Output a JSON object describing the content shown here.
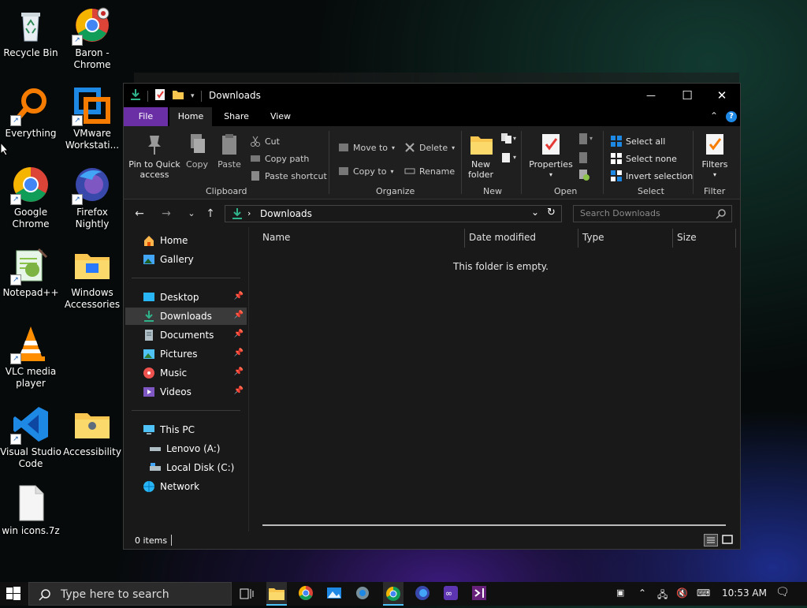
{
  "desktop": {
    "icons": [
      {
        "label": "Recycle Bin",
        "icon": "recycle-bin-icon"
      },
      {
        "label": "Baron - Chrome",
        "icon": "chrome-icon"
      },
      {
        "label": "Everything",
        "icon": "everything-search-icon"
      },
      {
        "label": "VMware Workstati...",
        "icon": "vmware-icon"
      },
      {
        "label": "Google Chrome",
        "icon": "chrome-icon"
      },
      {
        "label": "Firefox Nightly",
        "icon": "firefox-nightly-icon"
      },
      {
        "label": "Notepad++",
        "icon": "notepadpp-icon"
      },
      {
        "label": "Windows Accessories",
        "icon": "folder-icon"
      },
      {
        "label": "VLC media player",
        "icon": "vlc-icon"
      },
      {
        "label": "Visual Studio Code",
        "icon": "vscode-icon"
      },
      {
        "label": "Accessibility",
        "icon": "folder-icon"
      },
      {
        "label": "win icons.7z",
        "icon": "file-icon"
      }
    ]
  },
  "explorer": {
    "title": "Downloads",
    "window_controls": {
      "minimize": "—",
      "maximize": "☐",
      "close": "✕"
    },
    "tabs": {
      "file": "File",
      "home": "Home",
      "share": "Share",
      "view": "View"
    },
    "ribbon": {
      "clipboard": {
        "pin": "Pin to Quick access",
        "copy": "Copy",
        "paste": "Paste",
        "cut": "Cut",
        "copy_path": "Copy path",
        "paste_shortcut": "Paste shortcut",
        "label": "Clipboard"
      },
      "organize": {
        "move_to": "Move to",
        "copy_to": "Copy to",
        "delete": "Delete",
        "rename": "Rename",
        "label": "Organize"
      },
      "new": {
        "new_folder": "New folder",
        "label": "New"
      },
      "open": {
        "properties": "Properties",
        "label": "Open"
      },
      "select": {
        "select_all": "Select all",
        "select_none": "Select none",
        "invert": "Invert selection",
        "label": "Select"
      },
      "filter": {
        "filters": "Filters",
        "label": "Filter"
      }
    },
    "address": {
      "path": "Downloads",
      "search_placeholder": "Search Downloads"
    },
    "nav": {
      "home": "Home",
      "gallery": "Gallery",
      "quick": [
        "Desktop",
        "Downloads",
        "Documents",
        "Pictures",
        "Music",
        "Videos"
      ],
      "this_pc": "This PC",
      "drives": [
        "Lenovo (A:)",
        "Local Disk (C:)"
      ],
      "network": "Network"
    },
    "columns": {
      "name": "Name",
      "date": "Date modified",
      "type": "Type",
      "size": "Size"
    },
    "empty_message": "This folder is empty.",
    "status": "0 items"
  },
  "taskbar": {
    "search_placeholder": "Type here to search",
    "clock": "10:53 AM"
  },
  "colors": {
    "file_tab": "#6b2fa5",
    "accent_blue": "#1e88e5",
    "download_green": "#2fb38a"
  }
}
